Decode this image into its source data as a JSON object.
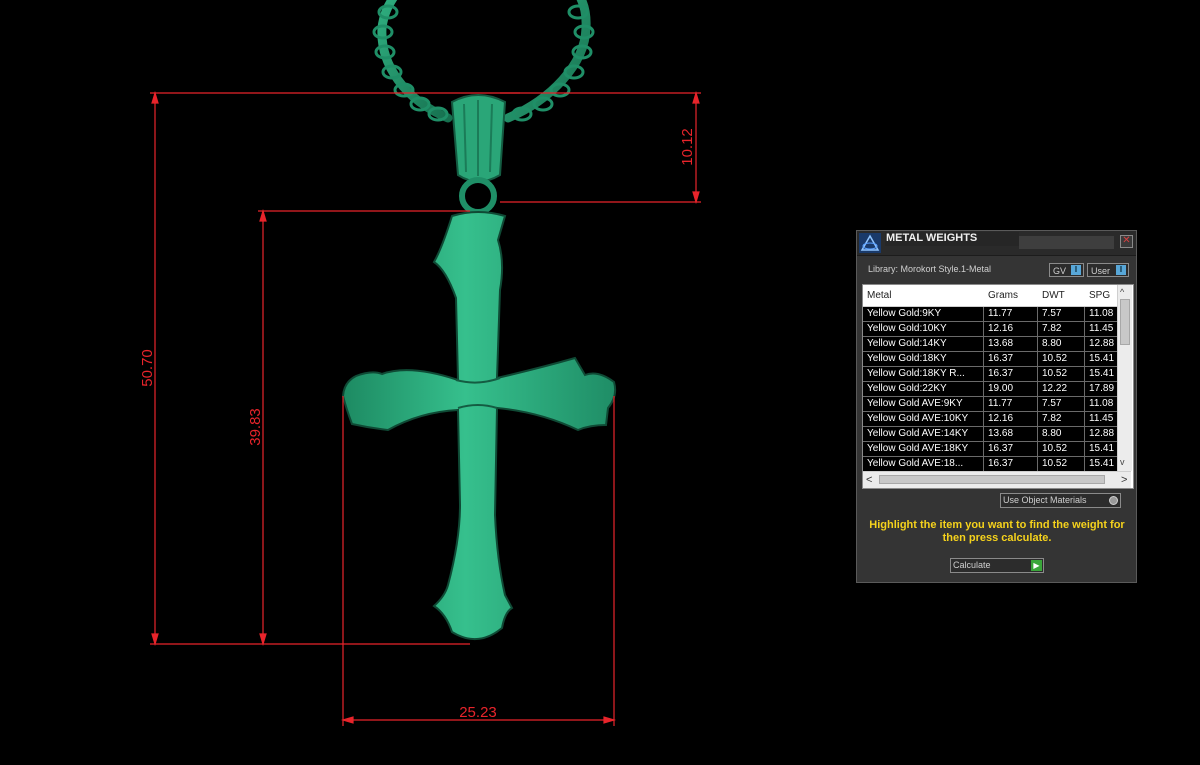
{
  "viewport": {
    "dimensions": {
      "overall_height": "50.70",
      "cross_height": "39.83",
      "bail_height": "10.12",
      "cross_width": "25.23"
    },
    "colors": {
      "dimension_line": "#e8242b",
      "model": "#2fae7f",
      "background": "#000000"
    }
  },
  "panel": {
    "title": "METAL WEIGHTS",
    "close_glyph": "✕",
    "library_label": "Library: Morokort Style.1-Metal",
    "toggles": [
      {
        "label": "GV",
        "glyph": "I"
      },
      {
        "label": "User",
        "glyph": "I"
      }
    ],
    "table": {
      "columns": [
        "Metal",
        "Grams",
        "DWT",
        "SPG"
      ],
      "rows": [
        [
          "Yellow Gold:9KY",
          "11.77",
          "7.57",
          "11.08"
        ],
        [
          "Yellow Gold:10KY",
          "12.16",
          "7.82",
          "11.45"
        ],
        [
          "Yellow Gold:14KY",
          "13.68",
          "8.80",
          "12.88"
        ],
        [
          "Yellow Gold:18KY",
          "16.37",
          "10.52",
          "15.41"
        ],
        [
          "Yellow Gold:18KY R...",
          "16.37",
          "10.52",
          "15.41"
        ],
        [
          "Yellow Gold:22KY",
          "19.00",
          "12.22",
          "17.89"
        ],
        [
          "Yellow Gold AVE:9KY",
          "11.77",
          "7.57",
          "11.08"
        ],
        [
          "Yellow Gold AVE:10KY",
          "12.16",
          "7.82",
          "11.45"
        ],
        [
          "Yellow Gold AVE:14KY",
          "13.68",
          "8.80",
          "12.88"
        ],
        [
          "Yellow Gold AVE:18KY",
          "16.37",
          "10.52",
          "15.41"
        ],
        [
          "Yellow Gold AVE:18...",
          "16.37",
          "10.52",
          "15.41"
        ]
      ]
    },
    "scroll_glyphs": {
      "up": "^",
      "down": "v",
      "left": "<",
      "right": ">"
    },
    "use_object_materials_label": "Use Object Materials",
    "instruction": "Highlight the item you want to find the weight for then press calculate.",
    "calculate_label": "Calculate",
    "calculate_arrow": "▶",
    "colors": {
      "instruction": "#f5d21c",
      "accent": "#58a7d8",
      "go": "#3aa63a"
    }
  }
}
